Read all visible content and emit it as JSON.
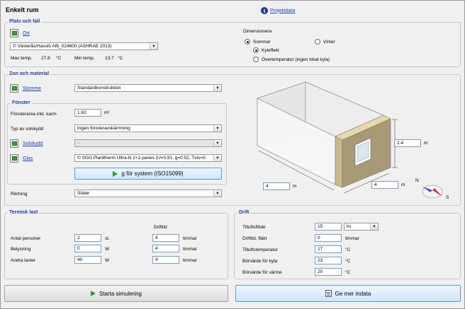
{
  "window": {
    "title": "Enkelt rum"
  },
  "project_link": "Projektdata",
  "plats": {
    "group_title": "Plats och fall",
    "ort_link": "Ort",
    "ort_value": "© Västerås/Hasslö Afb_024600 (ASHRAE 2013)",
    "max_temp_label": "Max temp.",
    "max_temp_value": "27.8",
    "max_temp_unit": "°C",
    "min_temp_label": "Min temp.",
    "min_temp_value": "13.7",
    "min_temp_unit": "°C"
  },
  "dimensionera": {
    "label": "Dimensionera",
    "sommar": "Sommar",
    "vinter": "Vinter",
    "kyleffekt": "Kyleffekt",
    "overtemp": "Övertemperatur (ingen lokal kyla)"
  },
  "zon": {
    "group_title": "Zon och material",
    "stomme_link": "Stomme",
    "stomme_value": "Standardkonstruktion"
  },
  "fonster": {
    "group_title": "Fönster",
    "area_label": "Fönsterarea inkl. karm",
    "area_value": "1.82",
    "area_unit": "m²",
    "solskydd_type_label": "Typ av solskydd",
    "solskydd_type_value": "Ingen fönsteravskärmning",
    "solskydd_link": "Solskydd",
    "solskydd_value": "--",
    "glas_link": "Glas",
    "glas_value": "© SGG Planitherm Ultra-N 2+1-panes (U=0.91, g=0.52, Tvis=0.",
    "system_button": "g för system (ISO15099)"
  },
  "riktning": {
    "label": "Riktning",
    "value": "Söder"
  },
  "room": {
    "height": "2.4",
    "width": "4",
    "depth": "4",
    "unit": "m",
    "compass_n": "N",
    "compass_s": "S"
  },
  "termisk": {
    "group_title": "Termisk last",
    "drifttid_header": "Drifttid",
    "rows": [
      {
        "label": "Antal personer",
        "value": "2",
        "unit": "st.",
        "drifttid": "4",
        "drifttid_unit": "timmar"
      },
      {
        "label": "Belysning",
        "value": "0",
        "unit": "W",
        "drifttid": "4",
        "drifttid_unit": "timmar"
      },
      {
        "label": "Andra laster",
        "value": "40",
        "unit": "W",
        "drifttid": "4",
        "drifttid_unit": "timmar"
      }
    ]
  },
  "drift": {
    "group_title": "Drift",
    "rows": [
      {
        "label": "Tilluftsflöde",
        "value": "15",
        "unit": "l/s"
      },
      {
        "label": "Drifttid, fläkt",
        "value": "0",
        "unit": "timmar"
      },
      {
        "label": "Tilluftstemperatur",
        "value": "17",
        "unit": "°C"
      },
      {
        "label": "Börvärde för kyla",
        "value": "23",
        "unit": "°C"
      },
      {
        "label": "Börvärde för värme",
        "value": "20",
        "unit": "°C"
      }
    ]
  },
  "buttons": {
    "start": "Starta simulering",
    "more": "Ge mer indata"
  }
}
